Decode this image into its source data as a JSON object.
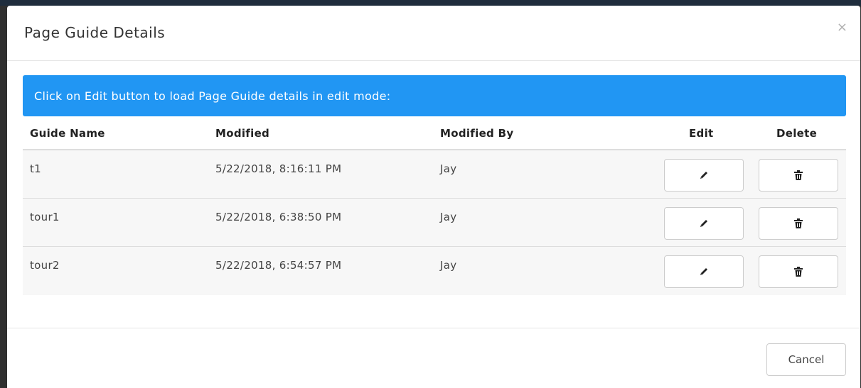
{
  "modal": {
    "title": "Page Guide Details",
    "close_label": "×"
  },
  "banner": {
    "text": "Click on Edit button to load Page Guide details in edit mode:"
  },
  "table": {
    "headers": {
      "name": "Guide Name",
      "modified": "Modified",
      "modified_by": "Modified By",
      "edit": "Edit",
      "delete": "Delete"
    },
    "rows": [
      {
        "name": "t1",
        "modified": "5/22/2018, 8:16:11 PM",
        "modified_by": "Jay",
        "edit_icon": "pencil-icon",
        "delete_icon": "trash-icon"
      },
      {
        "name": "tour1",
        "modified": "5/22/2018, 6:38:50 PM",
        "modified_by": "Jay",
        "edit_icon": "pencil-icon",
        "delete_icon": "trash-icon"
      },
      {
        "name": "tour2",
        "modified": "5/22/2018, 6:54:57 PM",
        "modified_by": "Jay",
        "edit_icon": "pencil-icon",
        "delete_icon": "trash-icon"
      }
    ]
  },
  "footer": {
    "cancel_label": "Cancel"
  },
  "colors": {
    "banner": "#2196f3",
    "row_background": "#f7f7f7"
  }
}
